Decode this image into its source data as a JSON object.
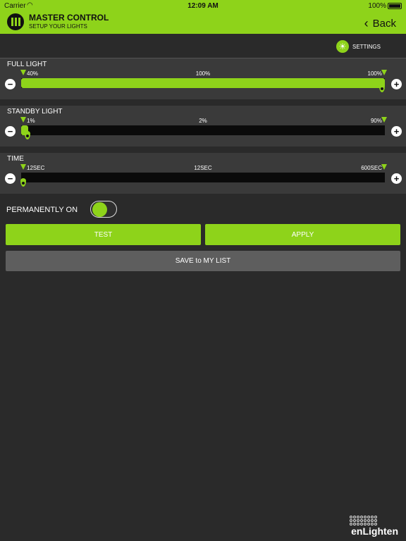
{
  "status": {
    "carrier": "Carrier",
    "time": "12:09 AM",
    "battery": "100%"
  },
  "header": {
    "title": "MASTER CONTROL",
    "subtitle": "SETUP YOUR LIGHTS",
    "back_label": "Back",
    "bg_color": "#8ed31a"
  },
  "settings": {
    "label": "SETTINGS",
    "icon": "gear-icon"
  },
  "sliders": {
    "full": {
      "label": "FULL LIGHT",
      "min_label": "40%",
      "current_label": "100%",
      "max_label": "100%",
      "fill_fraction": 1.0
    },
    "standby": {
      "label": "STANDBY LIGHT",
      "min_label": "1%",
      "current_label": "2%",
      "max_label": "90%",
      "fill_fraction": 0.02
    },
    "time": {
      "label": "TIME",
      "min_label": "12SEC",
      "current_label": "12SEC",
      "max_label": "600SEC",
      "fill_fraction": 0.0
    }
  },
  "permanently_on": {
    "label": "PERMANENTLY ON",
    "value": true
  },
  "buttons": {
    "test": "TEST",
    "apply": "APPLY",
    "save": "SAVE to MY LIST"
  },
  "brand": {
    "name": "enLighten"
  },
  "accent_color": "#8ed31a"
}
